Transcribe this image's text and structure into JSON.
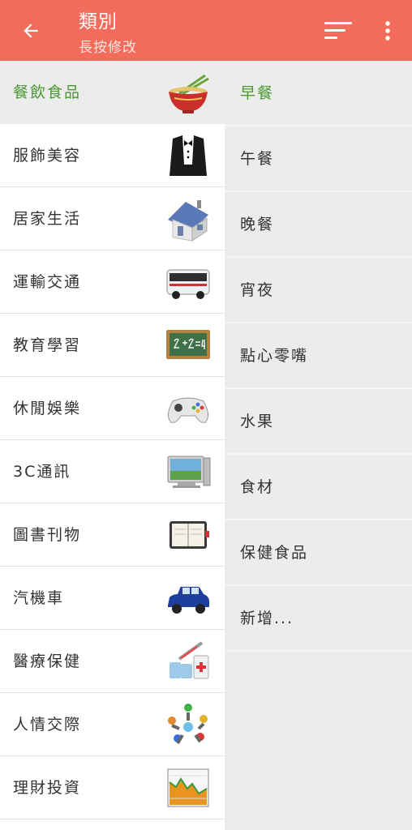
{
  "header": {
    "title": "類別",
    "subtitle": "長按修改",
    "back_icon": "arrow-left-icon",
    "sort_icon": "sort-icon",
    "more_icon": "more-vert-icon",
    "background_color": "#f26b5b"
  },
  "categories": [
    {
      "label": "餐飲食品",
      "icon": "noodle-bowl-icon",
      "selected": true
    },
    {
      "label": "服飾美容",
      "icon": "tuxedo-icon"
    },
    {
      "label": "居家生活",
      "icon": "house-icon"
    },
    {
      "label": "運輸交通",
      "icon": "bus-icon"
    },
    {
      "label": "教育學習",
      "icon": "chalkboard-icon"
    },
    {
      "label": "休閒娛樂",
      "icon": "gamepad-icon"
    },
    {
      "label": "3C通訊",
      "icon": "computer-icon"
    },
    {
      "label": "圖書刊物",
      "icon": "notebook-icon"
    },
    {
      "label": "汽機車",
      "icon": "car-icon"
    },
    {
      "label": "醫療保健",
      "icon": "medicine-icon"
    },
    {
      "label": "人情交際",
      "icon": "people-circle-icon"
    },
    {
      "label": "理財投資",
      "icon": "stock-chart-icon"
    }
  ],
  "subcategories": [
    {
      "label": "早餐",
      "selected": true
    },
    {
      "label": "午餐"
    },
    {
      "label": "晚餐"
    },
    {
      "label": "宵夜"
    },
    {
      "label": "點心零嘴"
    },
    {
      "label": "水果"
    },
    {
      "label": "食材"
    },
    {
      "label": "保健食品"
    },
    {
      "label": "新增..."
    }
  ],
  "colors": {
    "selected_text": "#4a9a34",
    "left_bg": "#ffffff",
    "right_bg": "#ececec"
  }
}
